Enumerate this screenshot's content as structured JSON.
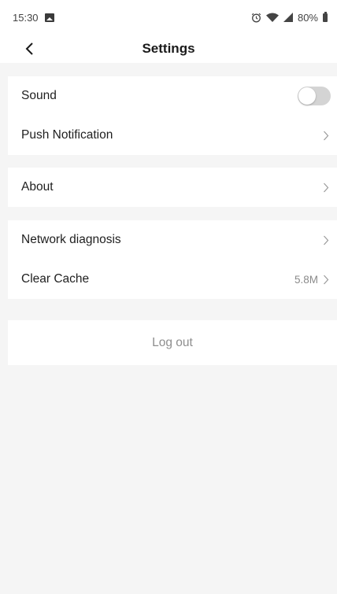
{
  "status_bar": {
    "time": "15:30",
    "battery": "80%"
  },
  "header": {
    "title": "Settings"
  },
  "groups": {
    "sound": {
      "label": "Sound",
      "toggle_on": false
    },
    "push_notification": {
      "label": "Push Notification"
    },
    "about": {
      "label": "About"
    },
    "network_diagnosis": {
      "label": "Network diagnosis"
    },
    "clear_cache": {
      "label": "Clear Cache",
      "value": "5.8M"
    }
  },
  "logout": {
    "label": "Log out"
  },
  "colors": {
    "background": "#f5f5f5",
    "card": "#ffffff",
    "toggle_off": "#d4d4d4",
    "secondary_text": "#8a8a8a"
  }
}
